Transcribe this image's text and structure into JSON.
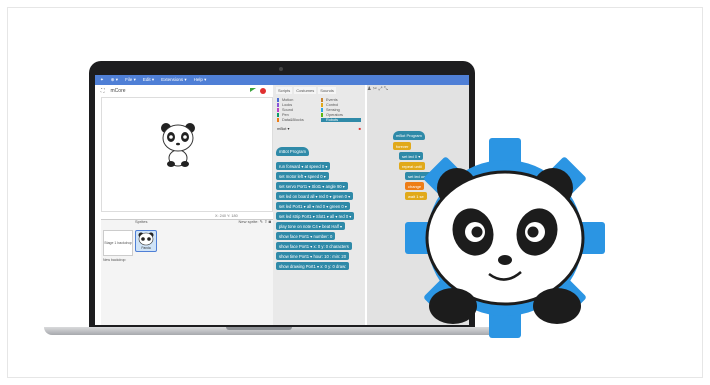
{
  "menubar": {
    "items": [
      "File ▾",
      "Edit ▾",
      "Extensions ▾",
      "Help ▾"
    ]
  },
  "stage": {
    "sprite_name": "mCore",
    "coords": "X: 240  Y: 180"
  },
  "sprites": {
    "header": "Sprites",
    "new_sprite_label": "New sprite:",
    "stage_thumb_label": "Stage\n1 backdrop",
    "new_backdrop_label": "New backdrop:",
    "sprite_thumb_label": "Panda"
  },
  "palette": {
    "tabs": [
      "Scripts",
      "Costumes",
      "Sounds"
    ],
    "categories": [
      "Motion",
      "Events",
      "Looks",
      "Control",
      "Sound",
      "Sensing",
      "Pen",
      "Operators",
      "Data&Blocks",
      "Robots"
    ],
    "active_category": "Robots",
    "device": "mBot ▾",
    "blocks": [
      "mBot Program",
      "run forward ▾ at speed 0 ▾",
      "set motor left ▾ speed 0 ▾",
      "set servo Port1 ▾ Slot1 ▾ angle 90 ▾",
      "set led on board all ▾ red 0 ▾ green 0 ▾",
      "set led Port1 ▾ all ▾ red 0 ▾ green 0 ▾",
      "set led strip Port1 ▾ Slot1 ▾ all ▾ red 0 ▾",
      "play tone on note C4 ▾ beat Half ▾",
      "show face Port1 ▾ number: 0",
      "show face Port1 ▾ x: 0 y: 0 characters",
      "show time Port1 ▾ hour: 10 : min: 20",
      "show drawing Port1 ▾ x: 0 y: 0 draw:"
    ]
  },
  "script": {
    "blocks": [
      "mBot Program",
      "forever",
      "set led 0 ▾",
      "repeat until",
      "set led on bo",
      "change",
      "wait 1 se"
    ]
  },
  "colors": {
    "menubar": "#4f7fd6",
    "block": "#2f8aa8",
    "gear": "#2b95e3"
  }
}
